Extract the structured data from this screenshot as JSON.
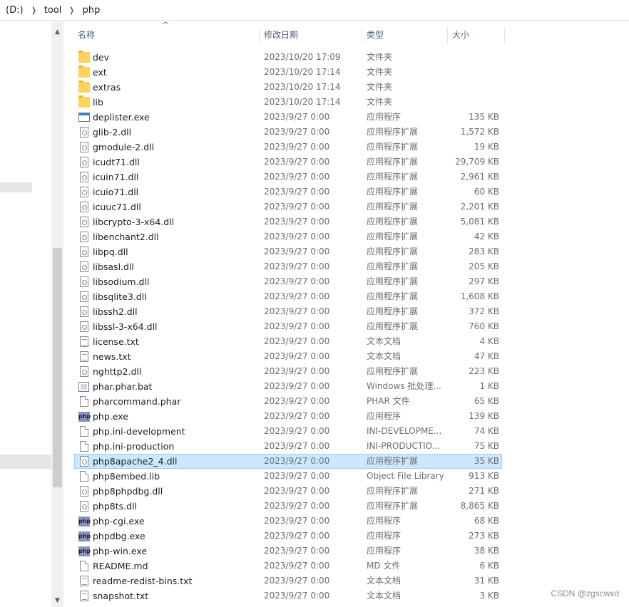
{
  "breadcrumb": [
    "(D:)",
    "tool",
    "php"
  ],
  "columns": {
    "name": "名称",
    "date": "修改日期",
    "type": "类型",
    "size": "大小"
  },
  "files": [
    {
      "name": "dev",
      "date": "2023/10/20 17:09",
      "type": "文件夹",
      "size": "",
      "icon": "folder"
    },
    {
      "name": "ext",
      "date": "2023/10/20 17:14",
      "type": "文件夹",
      "size": "",
      "icon": "folder"
    },
    {
      "name": "extras",
      "date": "2023/10/20 17:14",
      "type": "文件夹",
      "size": "",
      "icon": "folder"
    },
    {
      "name": "lib",
      "date": "2023/10/20 17:14",
      "type": "文件夹",
      "size": "",
      "icon": "folder"
    },
    {
      "name": "deplister.exe",
      "date": "2023/9/27 0:00",
      "type": "应用程序",
      "size": "135 KB",
      "icon": "exe"
    },
    {
      "name": "glib-2.dll",
      "date": "2023/9/27 0:00",
      "type": "应用程序扩展",
      "size": "1,572 KB",
      "icon": "dll"
    },
    {
      "name": "gmodule-2.dll",
      "date": "2023/9/27 0:00",
      "type": "应用程序扩展",
      "size": "19 KB",
      "icon": "dll"
    },
    {
      "name": "icudt71.dll",
      "date": "2023/9/27 0:00",
      "type": "应用程序扩展",
      "size": "29,709 KB",
      "icon": "dll"
    },
    {
      "name": "icuin71.dll",
      "date": "2023/9/27 0:00",
      "type": "应用程序扩展",
      "size": "2,961 KB",
      "icon": "dll"
    },
    {
      "name": "icuio71.dll",
      "date": "2023/9/27 0:00",
      "type": "应用程序扩展",
      "size": "60 KB",
      "icon": "dll"
    },
    {
      "name": "icuuc71.dll",
      "date": "2023/9/27 0:00",
      "type": "应用程序扩展",
      "size": "2,201 KB",
      "icon": "dll"
    },
    {
      "name": "libcrypto-3-x64.dll",
      "date": "2023/9/27 0:00",
      "type": "应用程序扩展",
      "size": "5,081 KB",
      "icon": "dll"
    },
    {
      "name": "libenchant2.dll",
      "date": "2023/9/27 0:00",
      "type": "应用程序扩展",
      "size": "42 KB",
      "icon": "dll"
    },
    {
      "name": "libpq.dll",
      "date": "2023/9/27 0:00",
      "type": "应用程序扩展",
      "size": "283 KB",
      "icon": "dll"
    },
    {
      "name": "libsasl.dll",
      "date": "2023/9/27 0:00",
      "type": "应用程序扩展",
      "size": "205 KB",
      "icon": "dll"
    },
    {
      "name": "libsodium.dll",
      "date": "2023/9/27 0:00",
      "type": "应用程序扩展",
      "size": "297 KB",
      "icon": "dll"
    },
    {
      "name": "libsqlite3.dll",
      "date": "2023/9/27 0:00",
      "type": "应用程序扩展",
      "size": "1,608 KB",
      "icon": "dll"
    },
    {
      "name": "libssh2.dll",
      "date": "2023/9/27 0:00",
      "type": "应用程序扩展",
      "size": "372 KB",
      "icon": "dll"
    },
    {
      "name": "libssl-3-x64.dll",
      "date": "2023/9/27 0:00",
      "type": "应用程序扩展",
      "size": "760 KB",
      "icon": "dll"
    },
    {
      "name": "license.txt",
      "date": "2023/9/27 0:00",
      "type": "文本文档",
      "size": "4 KB",
      "icon": "text"
    },
    {
      "name": "news.txt",
      "date": "2023/9/27 0:00",
      "type": "文本文档",
      "size": "47 KB",
      "icon": "text"
    },
    {
      "name": "nghttp2.dll",
      "date": "2023/9/27 0:00",
      "type": "应用程序扩展",
      "size": "223 KB",
      "icon": "dll"
    },
    {
      "name": "phar.phar.bat",
      "date": "2023/9/27 0:00",
      "type": "Windows 批处理...",
      "size": "1 KB",
      "icon": "bat"
    },
    {
      "name": "pharcommand.phar",
      "date": "2023/9/27 0:00",
      "type": "PHAR 文件",
      "size": "65 KB",
      "icon": "file"
    },
    {
      "name": "php.exe",
      "date": "2023/9/27 0:00",
      "type": "应用程序",
      "size": "139 KB",
      "icon": "php"
    },
    {
      "name": "php.ini-development",
      "date": "2023/9/27 0:00",
      "type": "INI-DEVELOPME...",
      "size": "74 KB",
      "icon": "file"
    },
    {
      "name": "php.ini-production",
      "date": "2023/9/27 0:00",
      "type": "INI-PRODUCTIO...",
      "size": "75 KB",
      "icon": "file"
    },
    {
      "name": "php8apache2_4.dll",
      "date": "2023/9/27 0:00",
      "type": "应用程序扩展",
      "size": "35 KB",
      "icon": "dll",
      "selected": true
    },
    {
      "name": "php8embed.lib",
      "date": "2023/9/27 0:00",
      "type": "Object File Library",
      "size": "913 KB",
      "icon": "file"
    },
    {
      "name": "php8phpdbg.dll",
      "date": "2023/9/27 0:00",
      "type": "应用程序扩展",
      "size": "271 KB",
      "icon": "dll"
    },
    {
      "name": "php8ts.dll",
      "date": "2023/9/27 0:00",
      "type": "应用程序扩展",
      "size": "8,865 KB",
      "icon": "dll"
    },
    {
      "name": "php-cgi.exe",
      "date": "2023/9/27 0:00",
      "type": "应用程序",
      "size": "68 KB",
      "icon": "php"
    },
    {
      "name": "phpdbg.exe",
      "date": "2023/9/27 0:00",
      "type": "应用程序",
      "size": "273 KB",
      "icon": "php"
    },
    {
      "name": "php-win.exe",
      "date": "2023/9/27 0:00",
      "type": "应用程序",
      "size": "38 KB",
      "icon": "php"
    },
    {
      "name": "README.md",
      "date": "2023/9/27 0:00",
      "type": "MD 文件",
      "size": "6 KB",
      "icon": "file"
    },
    {
      "name": "readme-redist-bins.txt",
      "date": "2023/9/27 0:00",
      "type": "文本文档",
      "size": "31 KB",
      "icon": "text"
    },
    {
      "name": "snapshot.txt",
      "date": "2023/9/27 0:00",
      "type": "文本文档",
      "size": "3 KB",
      "icon": "text"
    }
  ],
  "php_icon_label": "php",
  "watermark": "CSDN @zgscwxd"
}
